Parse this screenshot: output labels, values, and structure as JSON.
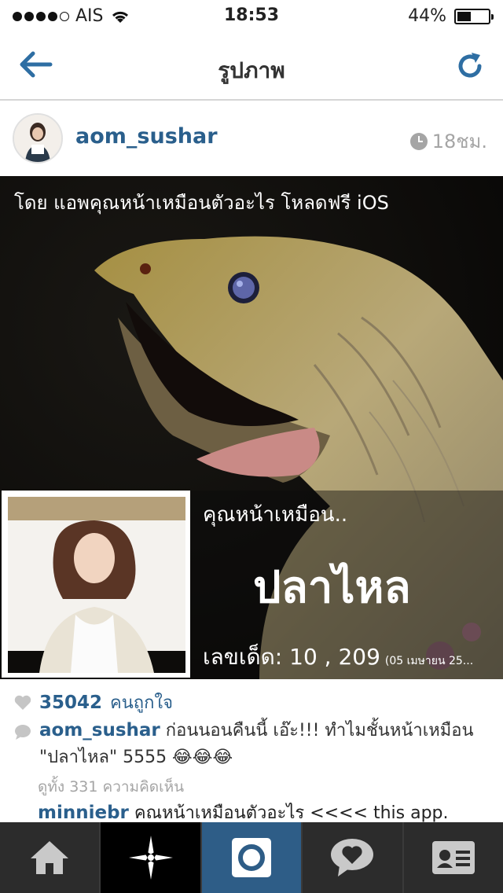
{
  "status_bar": {
    "carrier": "AIS",
    "time": "18:53",
    "battery_percent": "44%",
    "battery_level": 0.44,
    "signal_bars_filled": 4,
    "signal_bars_total": 5
  },
  "nav": {
    "title": "รูปภาพ",
    "back_icon": "back-arrow-icon",
    "refresh_icon": "refresh-icon"
  },
  "post": {
    "username": "aom_sushar",
    "time_ago": "18ชม.",
    "image": {
      "caption": "โดย แอพคุณหน้าเหมือนตัวอะไร โหลดฟรี iOS",
      "overlay_subtitle": "คุณหน้าเหมือน..",
      "overlay_result": "ปลาไหล",
      "overlay_lucky": "เลขเด็ด: 10 , 209",
      "overlay_date": "(05 เมษายน 25..."
    },
    "likes_count": "35042",
    "likes_label": "คนถูกใจ",
    "caption_user": "aom_sushar",
    "caption_text": "ก่อนนอนคืนนี้ เอ๊ะ!!! ทำไมชั้นหน้าเหมือน \"ปลาไหล\" 5555 😂😂😂",
    "view_all_prefix": "ดูทั้ง",
    "view_all_count": "331",
    "view_all_suffix": "ความคิดเห็น",
    "comment2_user": "minniebr",
    "comment2_text": "คณหน้าเหมือนตัวอะไร <<<< this app."
  },
  "tab_bar": {
    "tabs": [
      {
        "icon": "home-icon"
      },
      {
        "icon": "explore-star-icon"
      },
      {
        "icon": "camera-icon"
      },
      {
        "icon": "activity-heart-icon"
      },
      {
        "icon": "profile-card-icon"
      }
    ]
  },
  "colors": {
    "accent_blue": "#2a5f8c",
    "tab_active": "#2e5d87",
    "tab_bg": "#2c2c2c"
  }
}
